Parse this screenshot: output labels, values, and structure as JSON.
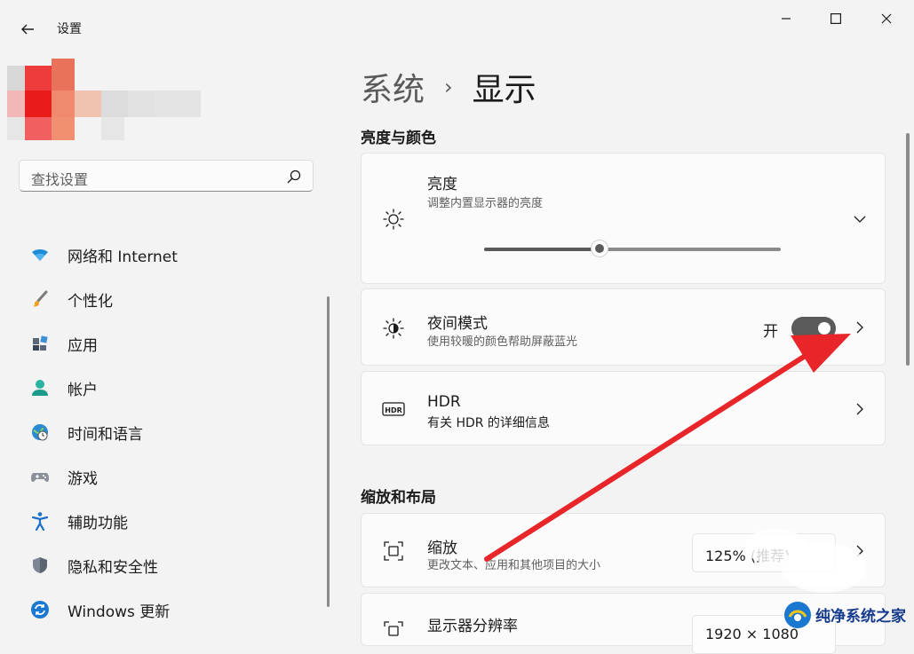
{
  "window": {
    "title": "设置",
    "minimize_icon": "minimize-icon",
    "maximize_icon": "maximize-icon",
    "close_icon": "close-icon"
  },
  "search": {
    "placeholder": "查找设置",
    "icon": "search-icon"
  },
  "sidebar": {
    "items": [
      {
        "label": "网络和 Internet",
        "icon": "wifi-icon"
      },
      {
        "label": "个性化",
        "icon": "brush-icon"
      },
      {
        "label": "应用",
        "icon": "apps-icon"
      },
      {
        "label": "帐户",
        "icon": "account-icon"
      },
      {
        "label": "时间和语言",
        "icon": "globe-clock-icon"
      },
      {
        "label": "游戏",
        "icon": "gamepad-icon"
      },
      {
        "label": "辅助功能",
        "icon": "accessibility-icon"
      },
      {
        "label": "隐私和安全性",
        "icon": "shield-icon"
      },
      {
        "label": "Windows 更新",
        "icon": "update-icon"
      }
    ]
  },
  "breadcrumb": {
    "parent": "系统",
    "separator": "›",
    "current": "显示"
  },
  "sections": {
    "brightness_color": "亮度与颜色",
    "scale_layout": "缩放和布局"
  },
  "cards": {
    "brightness": {
      "title": "亮度",
      "subtitle": "调整内置显示器的亮度",
      "icon": "sun-icon",
      "value_fraction": 0.39
    },
    "night_light": {
      "title": "夜间模式",
      "subtitle": "使用较暖的颜色帮助屏蔽蓝光",
      "icon": "night-light-icon",
      "toggle_label": "开",
      "toggle_on": true
    },
    "hdr": {
      "title": "HDR",
      "subtitle": "有关 HDR 的详细信息",
      "icon": "hdr-icon"
    },
    "scale": {
      "title": "缩放",
      "subtitle": "更改文本、应用和其他项目的大小",
      "icon": "scale-icon",
      "value": "125% (推荐)"
    },
    "resolution": {
      "title": "显示器分辨率",
      "icon": "resolution-icon",
      "value": "1920 × 1080"
    }
  },
  "annotation": {
    "arrow_color": "#e8262a"
  },
  "watermark": {
    "text": "纯净系统之家"
  },
  "colors": {
    "accent_dark": "#5a5a5a",
    "background": "#f3f3f3",
    "card": "#fbfbfb"
  }
}
